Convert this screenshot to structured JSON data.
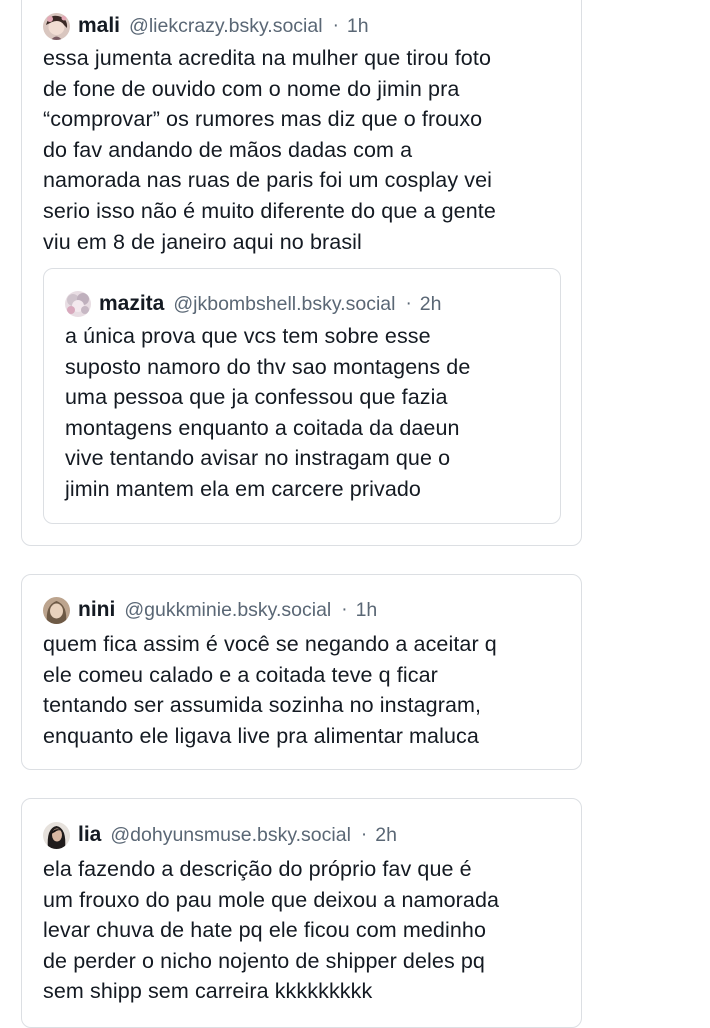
{
  "posts": [
    {
      "name": "mali",
      "handle": "@liekcrazy.bsky.social",
      "separator": "·",
      "time": "1h",
      "text": "essa jumenta acredita na mulher que tirou foto\nde fone de ouvido com o nome do jimin pra\n“comprovar” os rumores mas diz que o frouxo\ndo fav andando de mãos dadas com a\nnamorada nas ruas de paris foi um cosplay vei\nserio isso não é muito diferente do que a gente\nviu em 8 de janeiro aqui no brasil",
      "avatar_icon": "profile-photo",
      "quote": {
        "name": "mazita",
        "handle": "@jkbombshell.bsky.social",
        "separator": "·",
        "time": "2h",
        "text": "a única prova que vcs tem sobre esse\nsuposto namoro do thv sao montagens de\numa pessoa que ja confessou que fazia\nmontagens enquanto a coitada da daeun\nvive tentando avisar no instragam que o\njimin mantem ela em carcere privado",
        "avatar_icon": "profile-photo"
      }
    },
    {
      "name": "nini",
      "handle": "@gukkminie.bsky.social",
      "separator": "·",
      "time": "1h",
      "text": "quem fica assim é você se negando a aceitar q\nele comeu calado e a coitada teve q ficar\ntentando ser assumida sozinha no instagram,\nenquanto ele ligava live pra alimentar maluca",
      "avatar_icon": "profile-photo"
    },
    {
      "name": "lia",
      "handle": "@dohyunsmuse.bsky.social",
      "separator": "·",
      "time": "2h",
      "text": "ela fazendo a descrição do próprio fav que é\num frouxo do pau mole que deixou a namorada\nlevar chuva de hate pq ele ficou com medinho\nde perder o nicho nojento de shipper deles pq\nsem shipp sem carreira kkkkkkkkk",
      "avatar_icon": "profile-photo"
    }
  ],
  "colors": {
    "text": "#141a22",
    "secondary": "#5a6775",
    "border": "#dcdfe3",
    "background": "#ffffff"
  }
}
